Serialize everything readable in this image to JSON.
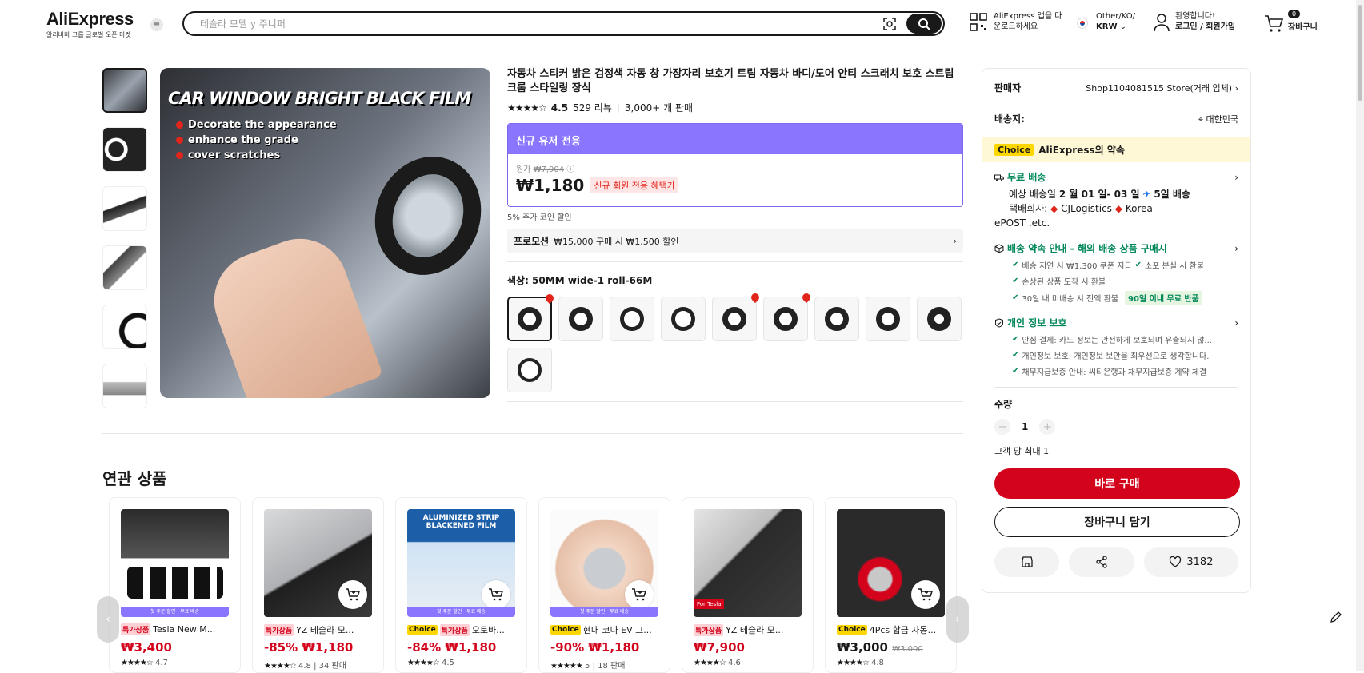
{
  "header": {
    "logo": "AliExpress",
    "logo_sub": "알리바바 그룹 글로벌 오픈 마켓",
    "search_placeholder": "테슬라 모델 y 주니퍼",
    "app_line1": "AliExpress 앱을 다",
    "app_line2": "운로드하세요",
    "region_line1": "Other/KO/",
    "region_line2": "KRW",
    "user_line1": "환영합니다!",
    "user_line2": "로그인 / 회원가입",
    "cart_count": "0",
    "cart_label": "장바구니"
  },
  "product": {
    "hero_title": "CAR WINDOW BRIGHT BLACK FILM",
    "hero_bullets": [
      "Decorate the appearance",
      "enhance the grade",
      "cover scratches"
    ],
    "title": "자동차 스티커 밝은 검정색 자동 창 가장자리 보호기 트림 자동차 바디/도어 안티 스크래치 보호 스트립 크롬 스타일링 장식",
    "stars": "★★★★☆",
    "rating": "4.5",
    "reviews": "529 리뷰",
    "sold": "3,000+ 개 판매",
    "new_user_label": "신규 유저 전용",
    "orig_label": "원가",
    "orig_price": "₩7,904",
    "price": "₩1,180",
    "price_tag": "신규 회원 전용 혜택가",
    "coin_text": "5% 추가 코인 할인",
    "promo_label": "프로모션",
    "promo_text": "₩15,000 구매 시 ₩1,500 할인",
    "color_label": "색상: 50MM wide-1 roll-66M"
  },
  "sidebar": {
    "seller_label": "판매자",
    "seller_value": "Shop1104081515 Store(거래 업체)",
    "ship_label": "배송지:",
    "ship_value": "대한민국",
    "choice_badge": "Choice",
    "choice_text": "AliExpress의 약속",
    "free_ship": "무료 배송",
    "eta_prefix": "예상 배송일",
    "eta_dates": "2 월 01 일- 03 일",
    "eta_days": "5일 배송",
    "carrier_label": "택배회사:",
    "carrier_1": "CJLogistics",
    "carrier_2": "Korea",
    "carrier_3": "ePOST ,etc.",
    "promise_head": "배송 약속 안내 - 해외 배송 상품 구매시",
    "promise_1a": "배송 지연 시 ₩1,300 쿠폰 지급",
    "promise_1b": "소포 분실 시 환불",
    "promise_2": "손상된 상품 도착 시 환불",
    "promise_3": "30일 내 미배송 시 전액 환불",
    "promise_3_pill": "90일 이내 무료 반품",
    "privacy_head": "개인 정보 보호",
    "privacy_1": "안심 결제: 카드 정보는 안전하게 보호되며 유출되지 않...",
    "privacy_2": "개인정보 보호: 개인정보 보안을 최우선으로 생각합니다.",
    "privacy_3": "채무지급보증 안내: 씨티은행과 채무지급보증 계약 체결",
    "qty_label": "수량",
    "qty_value": "1",
    "limit_text": "고객 당 최대 1",
    "buy_now": "바로 구매",
    "add_cart": "장바구니 담기",
    "wish_count": "3182"
  },
  "related": {
    "title": "연관 상품",
    "band": "첫 주문 할인 · 무료 배송",
    "cards": [
      {
        "badge": "특가상품",
        "badge2": "",
        "name": "Tesla New M...",
        "discount": "",
        "price": "₩3,400",
        "orig": "",
        "stars": "★★★★☆",
        "rating": "4.7",
        "sold": ""
      },
      {
        "badge": "특가상품",
        "badge2": "",
        "name": "YZ 테슬라 모...",
        "discount": "-85%",
        "price": "₩1,180",
        "orig": "",
        "stars": "★★★★☆",
        "rating": "4.8",
        "sold": "34 판매"
      },
      {
        "badge": "Choice",
        "badge2": "특가상품",
        "name": "오토바...",
        "discount": "-84%",
        "price": "₩1,180",
        "orig": "",
        "stars": "★★★★☆",
        "rating": "4.5",
        "sold": ""
      },
      {
        "badge": "Choice",
        "badge2": "",
        "name": "현대 코나 EV 그...",
        "discount": "-90%",
        "price": "₩1,180",
        "orig": "",
        "stars": "★★★★★",
        "rating": "5",
        "sold": "18 판매"
      },
      {
        "badge": "특가상품",
        "badge2": "",
        "name": "YZ 테슬라 모...",
        "discount": "",
        "price": "₩7,900",
        "orig": "",
        "stars": "★★★★☆",
        "rating": "4.6",
        "sold": ""
      },
      {
        "badge": "Choice",
        "badge2": "",
        "name": "4Pcs 합금 자동...",
        "discount": "",
        "price": "₩3,000",
        "orig": "₩3,000",
        "stars": "★★★★☆",
        "rating": "4.8",
        "sold": ""
      }
    ]
  }
}
